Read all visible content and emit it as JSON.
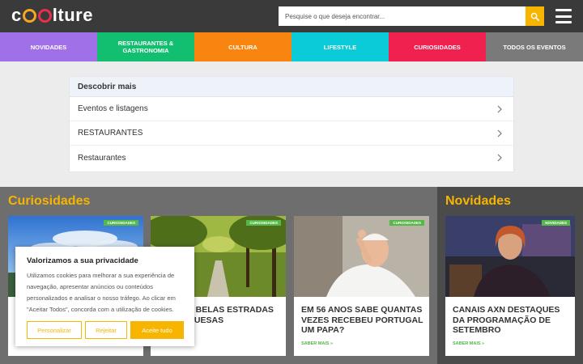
{
  "header": {
    "logo": {
      "prefix": "c",
      "suffix": "lture"
    },
    "search_placeholder": "Pesquise o que deseja encontrar...",
    "search_icon": "search-icon",
    "menu_icon": "hamburger-menu-icon"
  },
  "nav": [
    {
      "label": "NOVIDADES",
      "color": "#a070e8"
    },
    {
      "label": "RESTAURANTES & GASTRONOMIA",
      "color": "#12be6f"
    },
    {
      "label": "CULTURA",
      "color": "#f7850f"
    },
    {
      "label": "LIFESTYLE",
      "color": "#0bcbd8"
    },
    {
      "label": "CURIOSIDADES",
      "color": "#f0204f"
    },
    {
      "label": "TODOS OS EVENTOS",
      "color": "#7a7a7a"
    }
  ],
  "discover": {
    "title": "Descobrir mais",
    "items": [
      "Eventos e listagens",
      "RESTAURANTES",
      "Restaurantes"
    ]
  },
  "sections": {
    "left_title": "Curiosidades",
    "right_title": "Novidades"
  },
  "cards": [
    {
      "badge": "CURIOSIDADES",
      "title": "",
      "more": ""
    },
    {
      "badge": "CURIOSIDADES",
      "title": "AS MAIS BELAS ESTRADAS PORTUGUESAS",
      "more": ""
    },
    {
      "badge": "CURIOSIDADES",
      "title": "EM 56 ANOS SABE QUANTAS VEZES RECEBEU PORTUGAL UM PAPA?",
      "more": "SABER MAIS »"
    },
    {
      "badge": "NOVIDADES",
      "title": "CANAIS AXN DESTAQUES DA PROGRAMAÇÃO DE SETEMBRO",
      "more": "SABER MAIS »"
    }
  ],
  "cookie": {
    "title": "Valorizamos a sua privacidade",
    "text": "Utilizamos cookies para melhorar a sua experiência de navegação, apresentar anúncios ou conteúdos personalizados e analisar o nosso tráfego. Ao clicar em \"Aceitar Todos\", concorda com a utilização de cookies.",
    "customize": "Personalizar",
    "reject": "Rejeitar",
    "accept": "Aceite tudo"
  },
  "colors": {
    "accent": "#f7b500",
    "badge": "#55b848",
    "header_bg": "#3a3a3a"
  }
}
